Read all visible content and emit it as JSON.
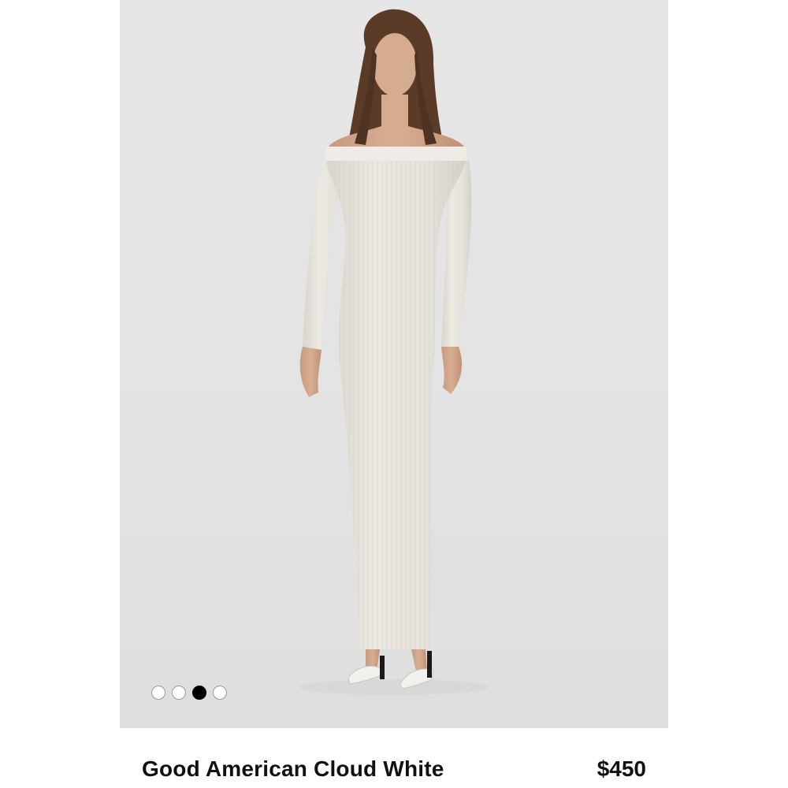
{
  "product": {
    "name": "Good American Cloud White",
    "price": "$450",
    "image_alt": "model wearing off-shoulder ribbed maxi dress"
  },
  "carousel": {
    "total": 4,
    "active_index": 2
  },
  "colors": {
    "background": "#ffffff",
    "image_backdrop": "#e4e4e4",
    "dress": "#e9e5df",
    "text": "#111111",
    "active_dot": "#000000"
  }
}
